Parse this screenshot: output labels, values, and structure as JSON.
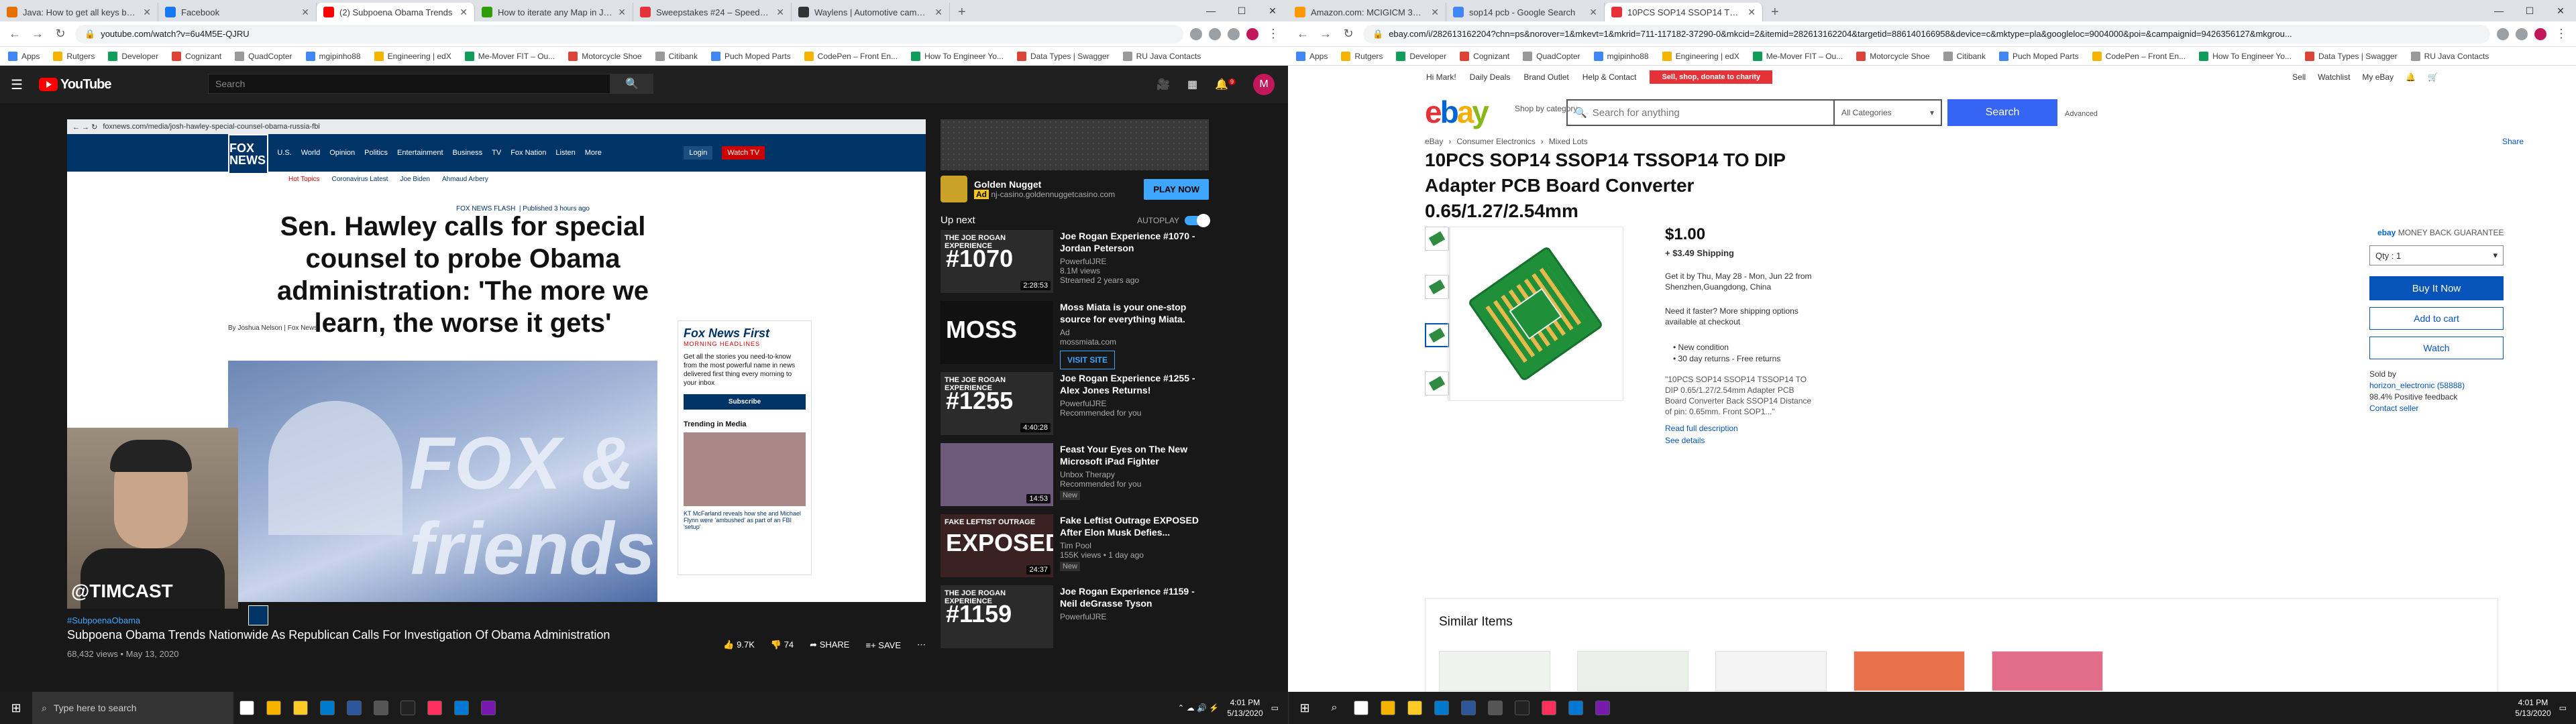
{
  "left_browser": {
    "tabs": [
      {
        "title": "Java: How to get all keys by a va",
        "color": "#e76f00",
        "active": false
      },
      {
        "title": "Facebook",
        "color": "#1877f2",
        "active": false
      },
      {
        "title": "(2) Subpoena Obama Trends",
        "color": "#ff0000",
        "active": true
      },
      {
        "title": "How to iterate any Map in Java",
        "color": "#2f9c0a",
        "active": false
      },
      {
        "title": "Sweepstakes #24 – Speed Society",
        "color": "#e53238",
        "active": false
      },
      {
        "title": "Waylens | Automotive cameras",
        "color": "#333333",
        "active": false
      }
    ],
    "url": "youtube.com/watch?v=6u4M5E-QJRU",
    "bookmarks": [
      "Apps",
      "Rutgers",
      "Developer",
      "Cognizant",
      "QuadCopter",
      "mgipinho88",
      "Engineering | edX",
      "Me-Mover FIT – Ou...",
      "Motorcycle Shoe",
      "Citibank",
      "Puch Moped Parts",
      "CodePen – Front En...",
      "How To Engineer Yo...",
      "Data Types | Swagger",
      "RU Java Contacts"
    ]
  },
  "youtube": {
    "logo": "YouTube",
    "search_placeholder": "Search",
    "notif_count": "9",
    "avatar_letter": "M",
    "video": {
      "screenshot_url": "foxnews.com/media/josh-hawley-special-counsel-obama-russia-fbi",
      "fox_logo": "FOX NEWS",
      "fox_nav": [
        "Coronavirus",
        "U.S.",
        "World",
        "Opinion",
        "Politics",
        "Entertainment",
        "Business",
        "TV",
        "Fox Nation",
        "Listen",
        "More"
      ],
      "fox_sub": [
        "Hot Topics",
        "Coronavirus Latest",
        "Joe Biden",
        "Ahmaud Arbery"
      ],
      "fox_buttons": [
        "Login",
        "Watch TV"
      ],
      "section_label": "FOX NEWS FLASH",
      "published": "Published 3 hours ago",
      "headline": "Sen. Hawley calls for special counsel to probe Obama administration: 'The more we learn, the worse it gets'",
      "byline": "By Joshua Nelson | Fox News",
      "hero_text": "FOX & friends",
      "newsletter_title": "Fox News First",
      "newsletter_sub": "MORNING HEADLINES",
      "newsletter_body": "Get all the stories you need-to-know from the most powerful name in news delivered first thing every morning to your inbox",
      "subscribe": "Subscribe",
      "trending": "Trending in Media",
      "trending_item": "KT McFarland reveals how she and Michael Flynn were 'ambushed' as part of an FBI 'setup'",
      "webcam_tag": "@TIMCAST"
    },
    "hashtag": "#SubpoenaObama",
    "title": "Subpoena Obama Trends Nationwide As Republican Calls For Investigation Of Obama Administration",
    "views": "68,432 views • May 13, 2020",
    "likes": "9.7K",
    "dislikes": "74",
    "share": "SHARE",
    "save": "SAVE",
    "ad": {
      "title": "Golden Nugget",
      "badge": "Ad",
      "domain": "nj-casino.goldennuggetcasino.com",
      "cta": "PLAY NOW"
    },
    "up_next": "Up next",
    "autoplay": "AUTOPLAY",
    "videos": [
      {
        "thumb_top": "THE JOE ROGAN EXPERIENCE",
        "thumb_big": "#1070",
        "title": "Joe Rogan Experience #1070 - Jordan Peterson",
        "channel": "PowerfulJRE",
        "meta": "8.1M views",
        "meta2": "Streamed 2 years ago",
        "duration": "2:28:53",
        "color": "#2b2b2b",
        "new": ""
      },
      {
        "thumb_top": "",
        "thumb_big": "MOSS",
        "title": "Moss Miata is your one-stop source for everything Miata.",
        "channel": "Ad",
        "meta": "mossmiata.com",
        "meta2": "",
        "duration": "",
        "color": "#111111",
        "new": "",
        "cta": "VISIT SITE"
      },
      {
        "thumb_top": "THE JOE ROGAN EXPERIENCE",
        "thumb_big": "#1255",
        "title": "Joe Rogan Experience #1255 - Alex Jones Returns!",
        "channel": "PowerfulJRE",
        "meta": "Recommended for you",
        "meta2": "",
        "duration": "4:40:28",
        "color": "#2b2b2b",
        "new": ""
      },
      {
        "thumb_top": "",
        "thumb_big": "",
        "title": "Feast Your Eyes on The New Microsoft iPad Fighter",
        "channel": "Unbox Therapy",
        "meta": "Recommended for you",
        "meta2": "",
        "duration": "14:53",
        "color": "#6b5a7a",
        "new": "New"
      },
      {
        "thumb_top": "FAKE LEFTIST OUTRAGE",
        "thumb_big": "EXPOSED",
        "title": "Fake Leftist Outrage EXPOSED After Elon Musk Defies...",
        "channel": "Tim Pool",
        "meta": "155K views • 1 day ago",
        "meta2": "",
        "duration": "24:37",
        "color": "#3a2222",
        "new": "New"
      },
      {
        "thumb_top": "THE JOE ROGAN EXPERIENCE",
        "thumb_big": "#1159",
        "title": "Joe Rogan Experience #1159 - Neil deGrasse Tyson",
        "channel": "PowerfulJRE",
        "meta": "",
        "meta2": "",
        "duration": "",
        "color": "#2b2b2b",
        "new": ""
      }
    ]
  },
  "right_browser": {
    "tabs": [
      {
        "title": "Amazon.com: MCIGICM 30pcs PCB",
        "color": "#ff9900",
        "active": false
      },
      {
        "title": "sop14 pcb - Google Search",
        "color": "#4285f4",
        "active": false
      },
      {
        "title": "10PCS SOP14 SSOP14 TSSOP14 TO",
        "color": "#e53238",
        "active": true
      }
    ],
    "url": "ebay.com/i/282613162204?chn=ps&norover=1&mkevt=1&mkrid=711-117182-37290-0&mkcid=2&itemid=282613162204&targetid=886140166958&device=c&mktype=pla&googleloc=9004000&poi=&campaignid=9426356127&mkgrou...",
    "bookmarks": [
      "Apps",
      "Rutgers",
      "Developer",
      "Cognizant",
      "QuadCopter",
      "mgipinho88",
      "Engineering | edX",
      "Me-Mover FIT – Ou...",
      "Motorcycle Shoe",
      "Citibank",
      "Puch Moped Parts",
      "CodePen – Front En...",
      "How To Engineer Yo...",
      "Data Types | Swagger",
      "RU Java Contacts"
    ]
  },
  "ebay": {
    "greeting": "Hi Mark!",
    "top_links": [
      "Daily Deals",
      "Brand Outlet",
      "Help & Contact"
    ],
    "charity": "Sell, shop, donate to charity",
    "right_links": [
      "Sell",
      "Watchlist",
      "My eBay"
    ],
    "shop_by": "Shop by category",
    "search_placeholder": "Search for anything",
    "category": "All Categories",
    "search_btn": "Search",
    "advanced": "Advanced",
    "breadcrumb": [
      "eBay",
      "Consumer Electronics",
      "Mixed Lots"
    ],
    "share": "Share",
    "title": "10PCS SOP14 SSOP14 TSSOP14 TO DIP Adapter PCB Board Converter 0.65/1.27/2.54mm",
    "price": "$1.00",
    "shipping": "+ $3.49 Shipping",
    "get_it": "Get it by Thu, May 28 - Mon, Jun 22 from Shenzhen,Guangdong, China",
    "need_it": "Need it faster? More shipping options available at checkout",
    "bullets": [
      "• New condition",
      "• 30 day returns - Free returns"
    ],
    "quote": "\"10PCS SOP14 SSOP14 TSSOP14 TO DIP 0.65/1.27/2.54mm Adapter PCB Board Converter Back SSOP14 Distance of pin: 0.65mm. Front SOP1...\"",
    "read_full": "Read full description",
    "see_details": "See details",
    "guarantee": "MONEY BACK GUARANTEE",
    "qty_label": "Qty : 1",
    "buy_now": "Buy It Now",
    "add_cart": "Add to cart",
    "watch": "Watch",
    "sold_by": "Sold by",
    "seller_name": "horizon_electronic (58888)",
    "feedback": "98.4% Positive feedback",
    "contact": "Contact seller",
    "similar": "Similar Items"
  },
  "taskbar": {
    "search_text": "Type here to search",
    "time": "4:01 PM",
    "date": "5/13/2020",
    "icons": [
      {
        "name": "task-view",
        "color": "#ffffff"
      },
      {
        "name": "chrome",
        "color": "#f4b400"
      },
      {
        "name": "explorer",
        "color": "#ffca28"
      },
      {
        "name": "vscode",
        "color": "#007acc"
      },
      {
        "name": "word",
        "color": "#2b579a"
      },
      {
        "name": "calculator",
        "color": "#555555"
      },
      {
        "name": "terminal",
        "color": "#222222"
      },
      {
        "name": "intellij",
        "color": "#fe315d"
      },
      {
        "name": "outlook",
        "color": "#0078d4"
      },
      {
        "name": "notes",
        "color": "#7719aa"
      }
    ]
  }
}
